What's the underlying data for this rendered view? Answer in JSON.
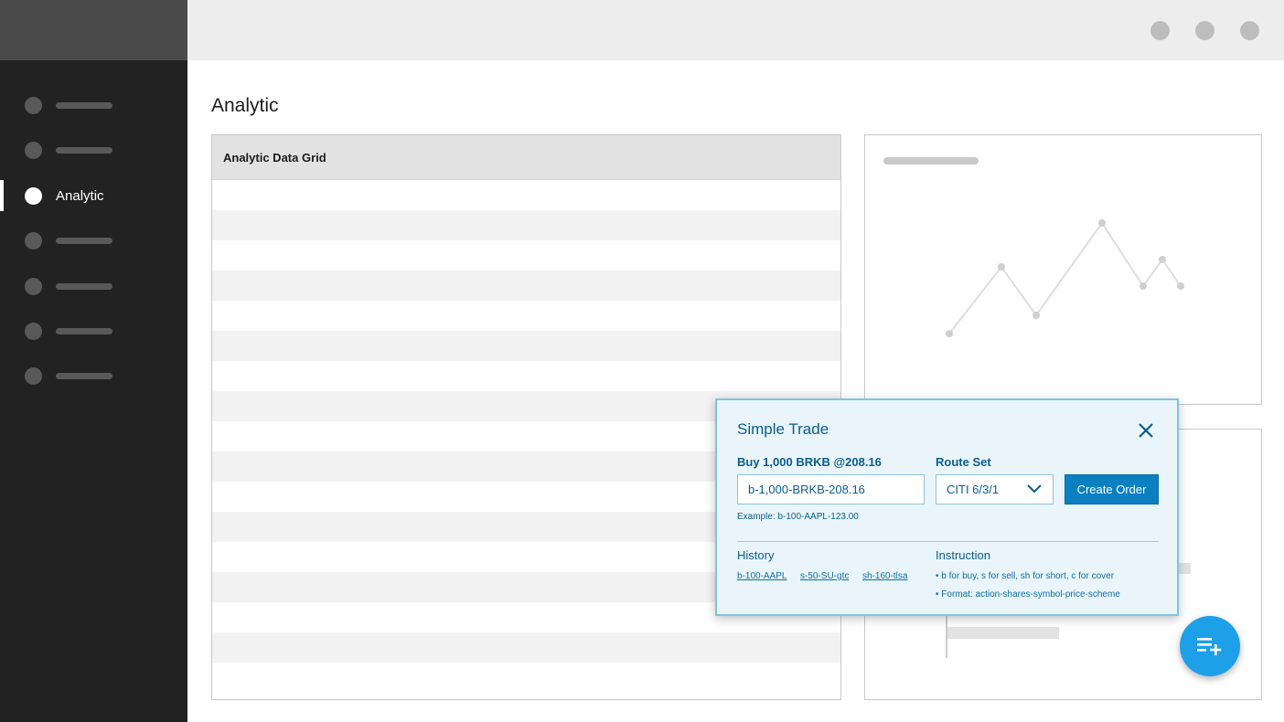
{
  "sidebar": {
    "items": [
      {
        "label": "",
        "active": false
      },
      {
        "label": "",
        "active": false
      },
      {
        "label": "Analytic",
        "active": true
      },
      {
        "label": "",
        "active": false
      },
      {
        "label": "",
        "active": false
      },
      {
        "label": "",
        "active": false
      },
      {
        "label": "",
        "active": false
      }
    ]
  },
  "page": {
    "title": "Analytic"
  },
  "grid": {
    "title": "Analytic Data Grid"
  },
  "dialog": {
    "title": "Simple Trade",
    "order_label": "Buy 1,000 BRKB @208.16",
    "order_value": "b-1,000-BRKB-208.16",
    "route_label": "Route Set",
    "route_value": "CITI 6/3/1",
    "create_button": "Create Order",
    "example": "Example: b-100-AAPL-123.00",
    "history_label": "History",
    "history_links": [
      "b-100-AAPL",
      "s-50-SU-gtc",
      "sh-160-tlsa"
    ],
    "instruction_label": "Instruction",
    "instructions": [
      "• b for buy, s for sell, sh for short, c for cover",
      "• Format: action-shares-symbol-price-scheme"
    ]
  },
  "icons": {
    "close": "close-icon",
    "chevron": "chevron-down-icon",
    "fab": "add-to-list-icon"
  },
  "colors": {
    "accent": "#0a7fc2",
    "fab": "#1ea0e8",
    "sidebar": "#222222"
  }
}
